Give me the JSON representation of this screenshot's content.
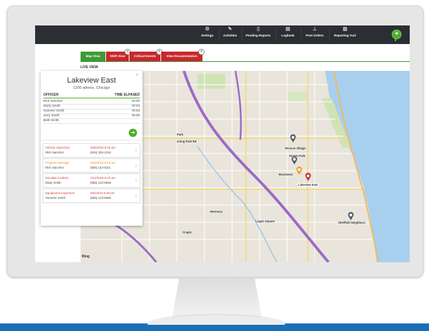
{
  "nav": {
    "items": [
      {
        "label": "Settings",
        "icon": "gear-icon"
      },
      {
        "label": "Activities",
        "icon": "pencil-icon"
      },
      {
        "label": "Pending Reports",
        "icon": "document-icon"
      },
      {
        "label": "Logbook",
        "icon": "book-icon"
      },
      {
        "label": "Post Orders",
        "icon": "clipboard-icon"
      },
      {
        "label": "Reporting Tool",
        "icon": "bar-chart-icon"
      }
    ],
    "add_icon": "plus-icon"
  },
  "tabs": [
    {
      "label": "Map View",
      "color": "#3f9a35",
      "closable": false
    },
    {
      "label": "Shift View",
      "color": "#c8282d",
      "closable": true
    },
    {
      "label": "Critical Events",
      "color": "#c8282d",
      "closable": true
    },
    {
      "label": "View Documentation",
      "color": "#c8282d",
      "closable": true
    }
  ],
  "live_view_label": "LIVE VIEW",
  "panel": {
    "title": "Lakeview East",
    "address": "1200 adress, Chicago",
    "col_officer": "OFFICER",
    "col_time": "TIME ELPASED",
    "officers": [
      {
        "name": "Rick Sanchez",
        "time": "00:00"
      },
      {
        "name": "Morty Smith",
        "time": "00:03"
      },
      {
        "name": "Summer Smith",
        "time": "00:03"
      },
      {
        "name": "Jerry Smith",
        "time": "00:06"
      },
      {
        "name": "Beth Smith",
        "time": ""
      }
    ],
    "incidents": [
      {
        "type": "Vehicle Inspection",
        "name": "Rick Sanchez",
        "date": "3/26/2015 8:16 am",
        "phone": "(815) 333-1234",
        "color": "#d23a3a"
      },
      {
        "type": "Property Damage",
        "name": "Rick Sanchez",
        "date": "3/26/2015 8:16 am",
        "phone": "(555) 123-5311",
        "color": "#ef8a1e"
      },
      {
        "type": "Escalate Incident",
        "name": "Misty Smith",
        "date": "1/12/2015 6:23 am",
        "phone": "(555) 123-5555",
        "color": "#d23a3a"
      },
      {
        "type": "Equipment Inspection",
        "name": "Summer Smith",
        "date": "3/6/10/10 6:45 pm",
        "phone": "(555) 123-5555",
        "color": "#d23a3a"
      }
    ]
  },
  "map": {
    "labels": [
      "Roscoe Village",
      "Homer Park",
      "Boystown",
      "Lakeview East",
      "Sheffield Neighbors",
      "Logan Square",
      "Hermosa",
      "Irving Park Rd",
      "Cragin",
      "Park"
    ],
    "attribution": "Bing"
  }
}
